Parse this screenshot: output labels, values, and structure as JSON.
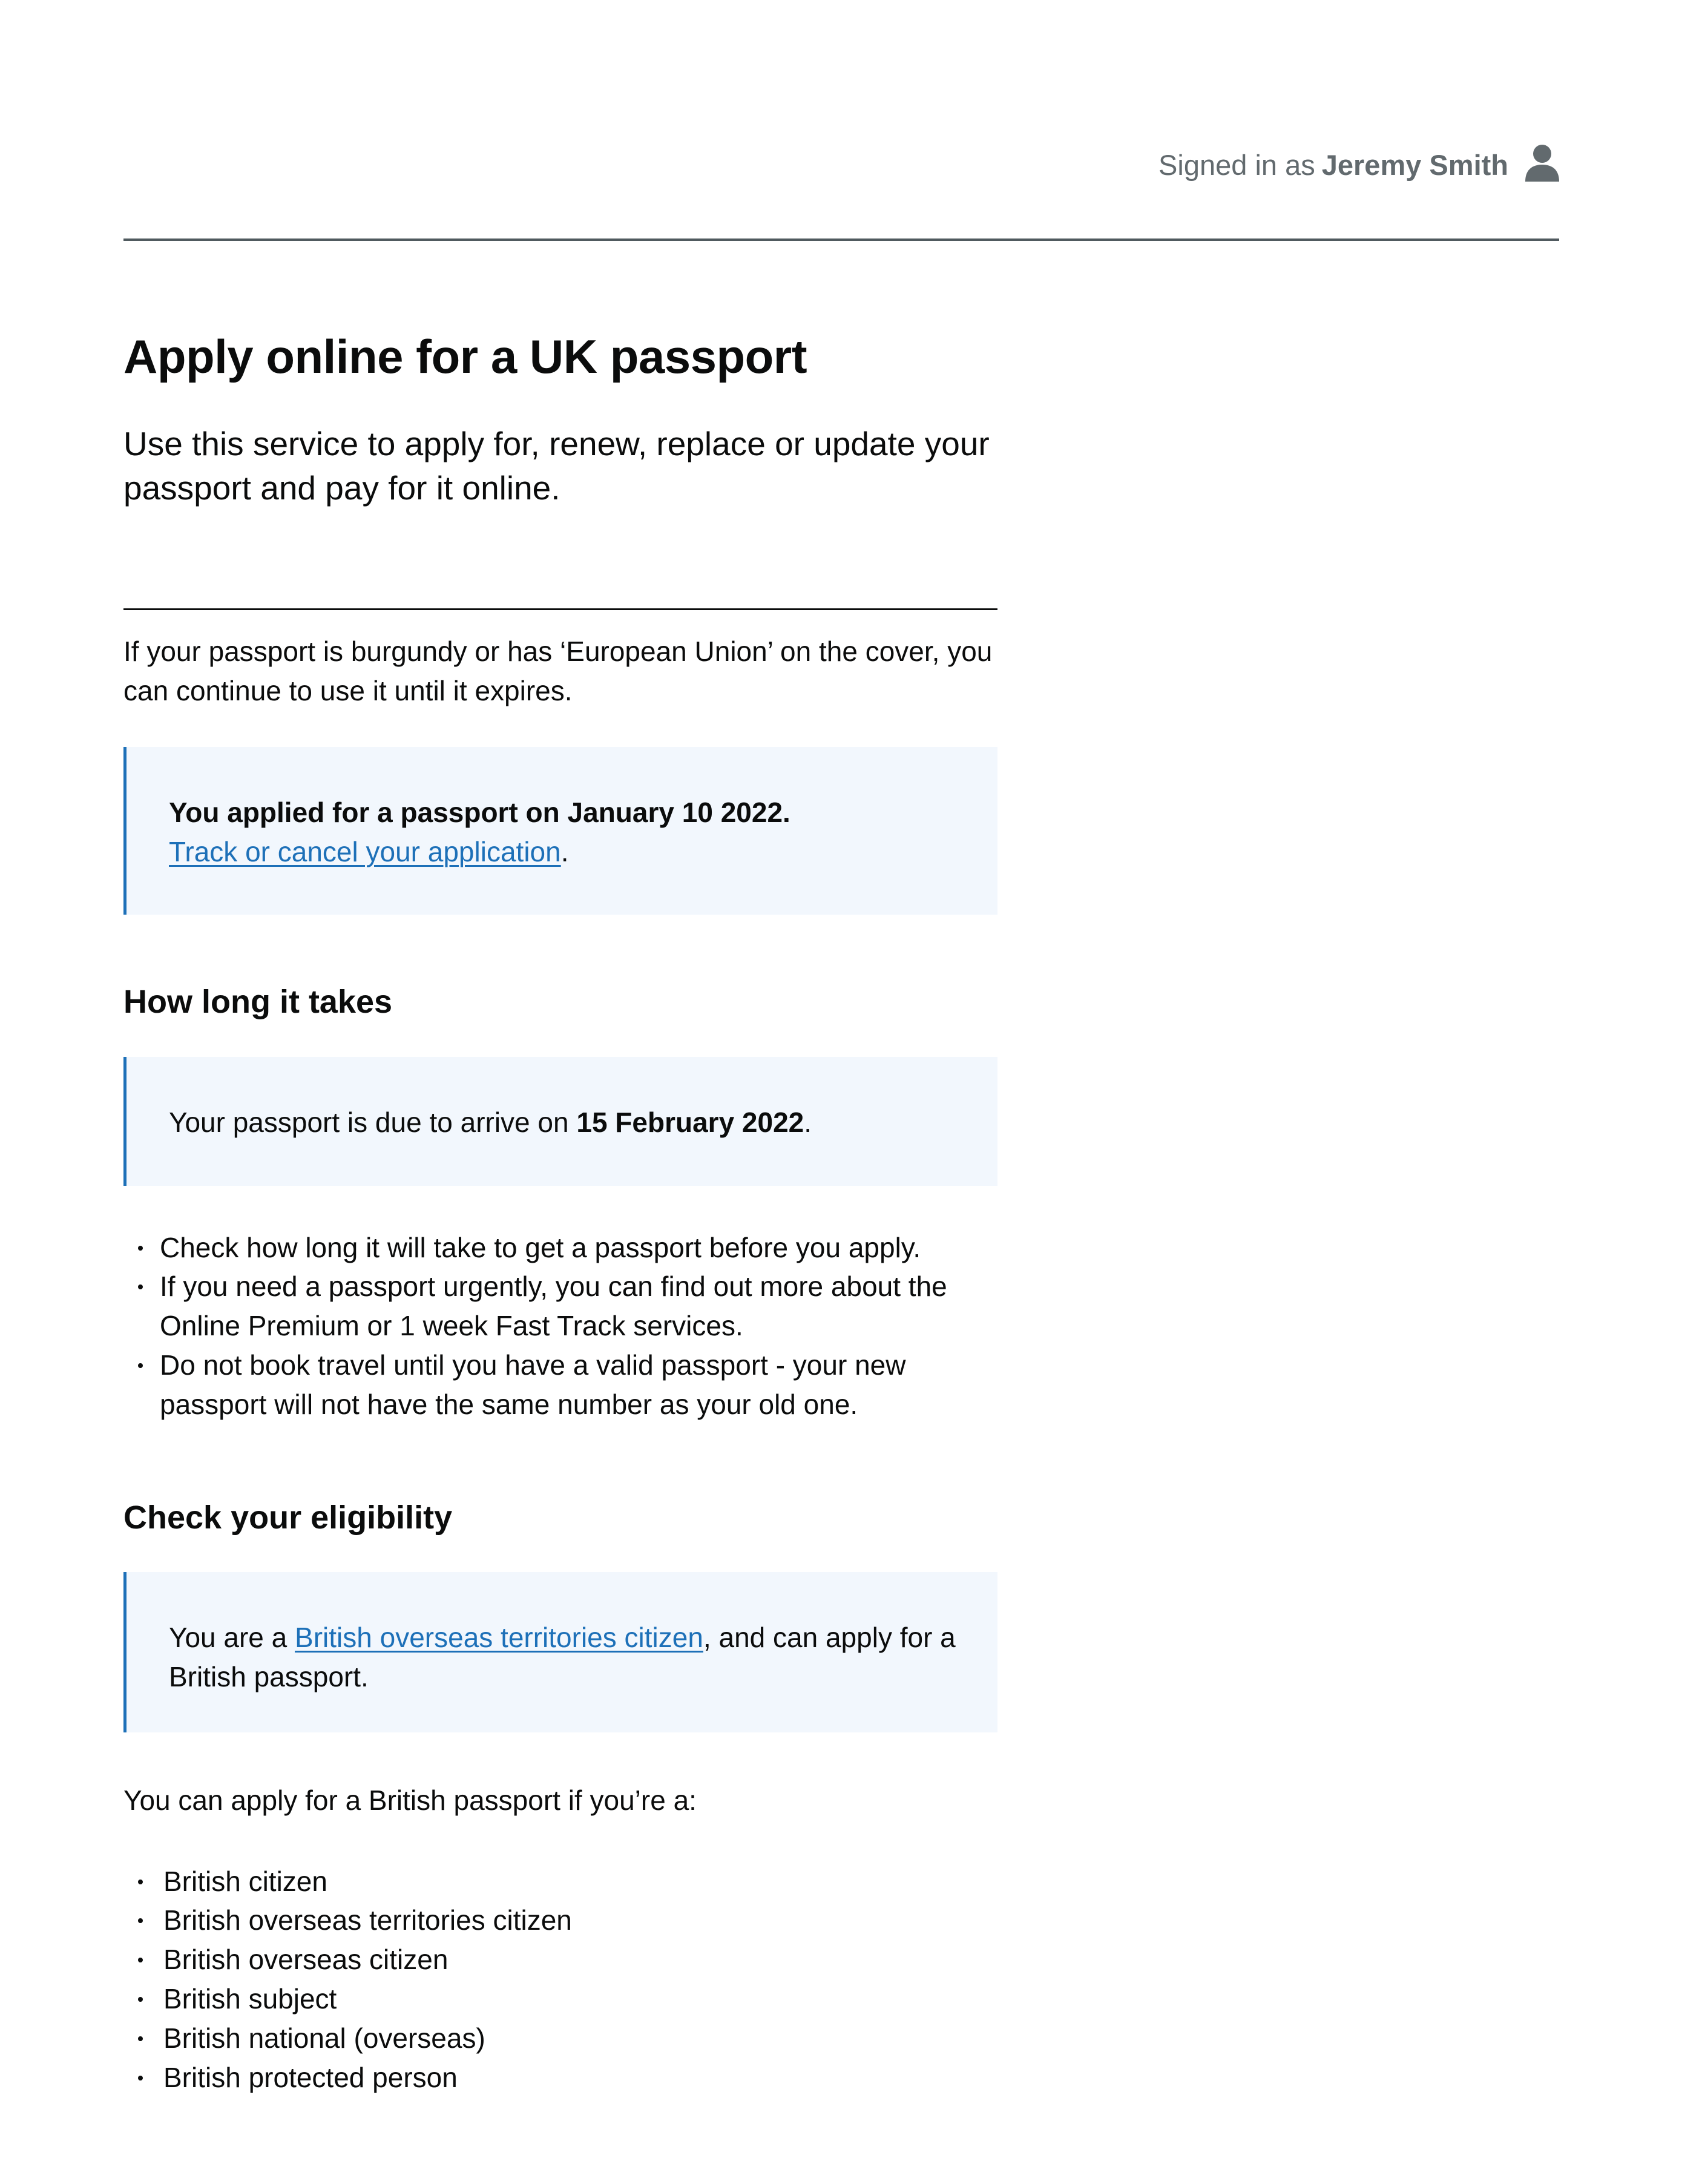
{
  "header": {
    "signed_in_prefix": "Signed in as",
    "user_name": "Jeremy Smith",
    "user_icon": "person-icon"
  },
  "main": {
    "title": "Apply online for a UK passport",
    "lead": "Use this service to apply for, renew, replace or update your passport and pay for it online.",
    "eu_note": "If your passport is burgundy or has ‘European Union’ on the cover, you can continue to use it until it expires.",
    "application_notice": {
      "text": "You applied for a passport on January 10 2022.",
      "link_label": "Track or cancel your application",
      "suffix": "."
    },
    "how_long": {
      "heading": "How long it takes",
      "arrival_prefix": "Your passport is due to arrive on ",
      "arrival_date": "15 February 2022",
      "arrival_suffix": ".",
      "bullets": [
        "Check how long it will take to get a passport before you apply.",
        "If you need a passport urgently, you can find out more about the Online Premium or 1 week Fast Track services.",
        "Do not book travel until you have a valid passport - your new passport will not have the same number as your old one."
      ]
    },
    "eligibility": {
      "heading": "Check your eligibility",
      "notice_prefix": "You are a ",
      "notice_link": "British overseas territories citizen",
      "notice_suffix": ", and can apply for a British passport.",
      "intro": "You can apply for a British passport if you’re a:",
      "categories": [
        "British citizen",
        "British overseas territories citizen",
        "British overseas citizen",
        "British subject",
        "British national (overseas)",
        "British protected person"
      ]
    }
  },
  "colors": {
    "link": "#1d70b8",
    "notice_background": "#f2f7fd",
    "notice_border": "#1d70b8",
    "text": "#0b0c0c",
    "muted": "#626a6e"
  }
}
